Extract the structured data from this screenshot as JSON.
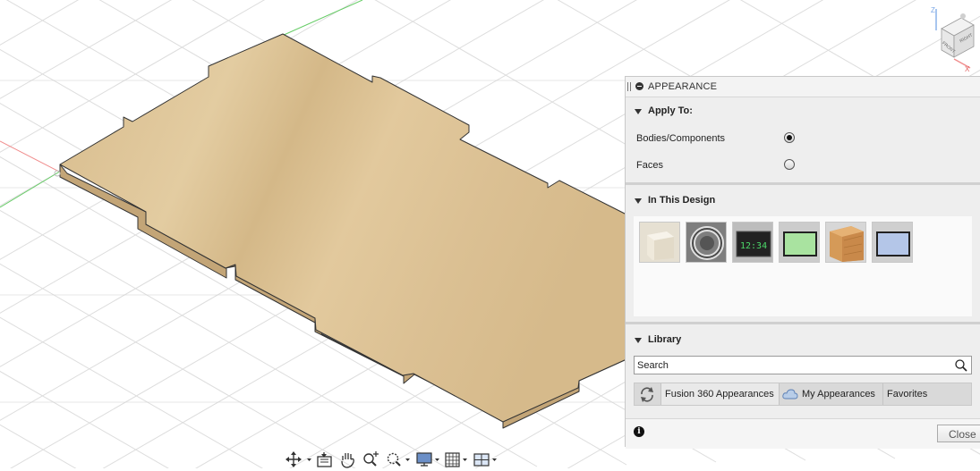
{
  "panel": {
    "title": "APPEARANCE",
    "apply_to": {
      "header": "Apply To:",
      "options": [
        {
          "label": "Bodies/Components",
          "selected": true
        },
        {
          "label": "Faces",
          "selected": false
        }
      ]
    },
    "in_this_design": {
      "header": "In This Design",
      "swatches": [
        "plaster-white-swatch",
        "chrome-ring-swatch",
        "green-lcd-display-swatch",
        "green-lcd-screen-swatch",
        "wood-oak-swatch",
        "blue-lcd-screen-swatch"
      ]
    },
    "library": {
      "header": "Library",
      "search_placeholder": "Search",
      "tabs": [
        "Fusion 360 Appearances",
        "My Appearances",
        "Favorites"
      ]
    },
    "footer": {
      "info_icon": "i",
      "close_label": "Close"
    }
  },
  "swatch_text": {
    "lcd_digits": "12:34"
  },
  "viewcube": {
    "axis_z": "Z",
    "axis_x": "X",
    "face_front": "FRONT",
    "face_right": "RIGHT"
  },
  "navigation_bar": {
    "tools": [
      "orbit-icon",
      "look-at-icon",
      "pan-icon",
      "zoom-icon",
      "fit-icon",
      "display-settings-icon",
      "grid-settings-icon",
      "viewports-icon"
    ]
  },
  "colors": {
    "wood_top": "#dcc192",
    "wood_side": "#cdb283",
    "grid_line": "#d9d9d9",
    "axis_red": "#f08c8c",
    "axis_green": "#66cc66",
    "panel_bg": "#eeeeee"
  }
}
